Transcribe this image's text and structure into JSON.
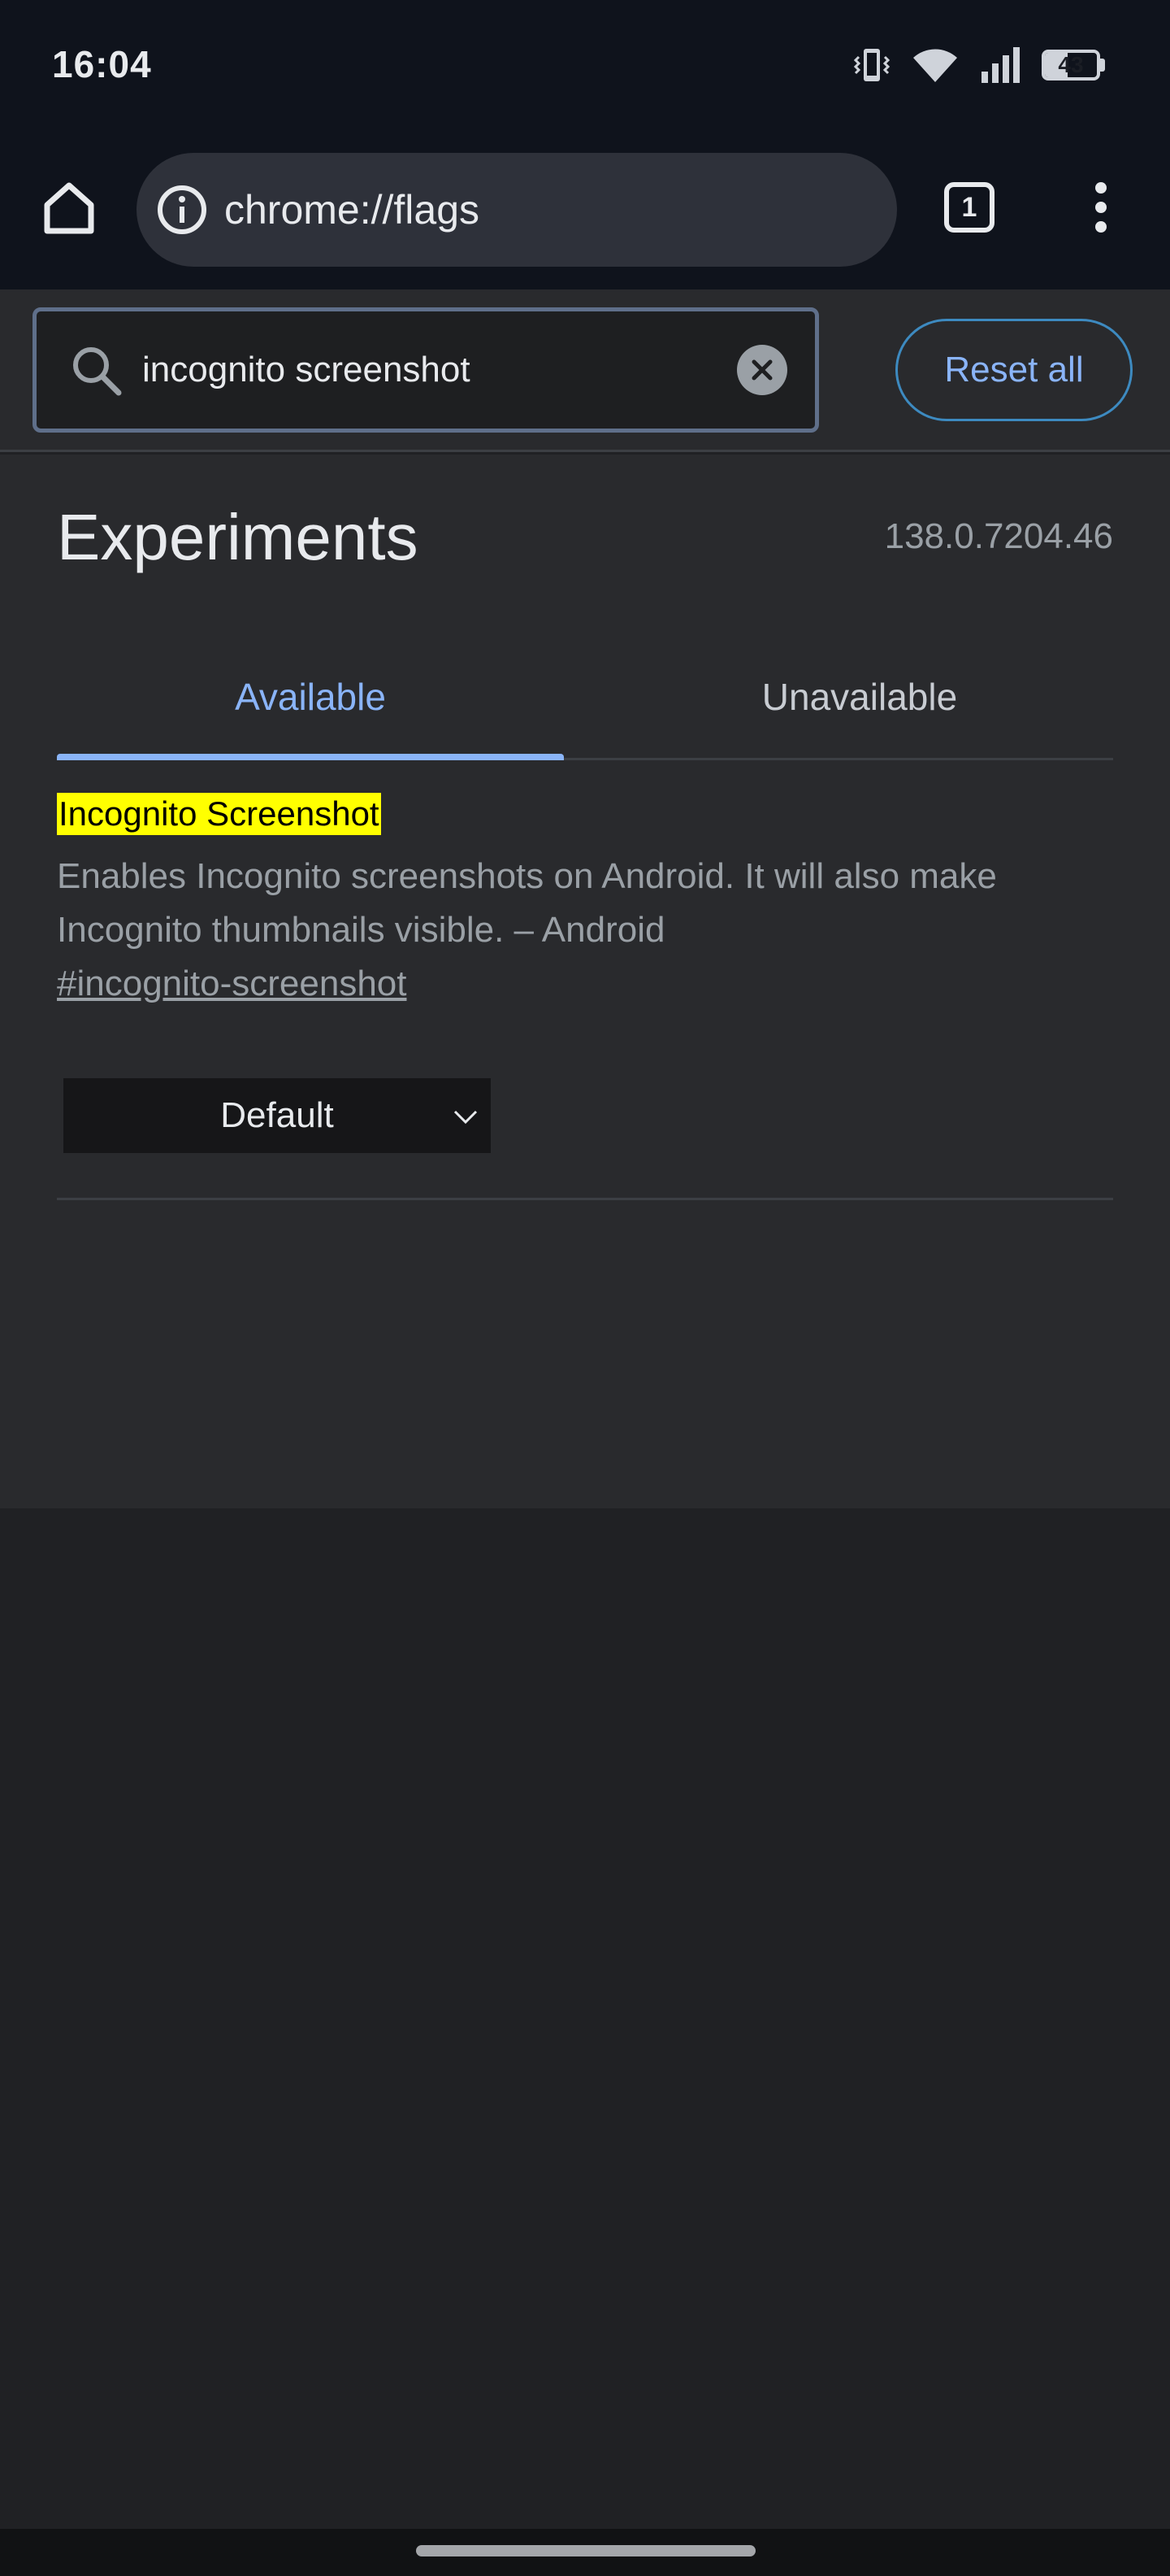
{
  "status_bar": {
    "time": "16:04",
    "battery_level": "43",
    "icons": [
      "vibrate-icon",
      "wifi-icon",
      "signal-icon",
      "battery-icon"
    ]
  },
  "toolbar": {
    "url": "chrome://flags",
    "tab_count": "1"
  },
  "search": {
    "query": "incognito screenshot",
    "reset_label": "Reset all"
  },
  "page": {
    "title": "Experiments",
    "version": "138.0.7204.46",
    "tabs": [
      {
        "label": "Available",
        "active": true
      },
      {
        "label": "Unavailable",
        "active": false
      }
    ]
  },
  "flags": [
    {
      "title": "Incognito Screenshot",
      "description": "Enables Incognito screenshots on Android. It will also make Incognito thumbnails visible. – Android",
      "anchor": "#incognito-screenshot",
      "selected_option": "Default"
    }
  ],
  "colors": {
    "accent": "#8ab4f8",
    "highlight": "#ffff00",
    "background": "#202124",
    "panel": "#292a2d",
    "toolbar": "#0f131c"
  }
}
